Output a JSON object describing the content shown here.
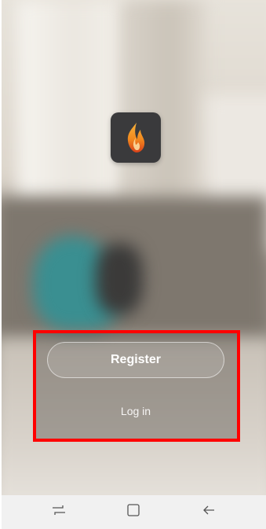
{
  "login_screen": {
    "app_icon": "flame-icon",
    "register_label": "Register",
    "login_label": "Log in"
  },
  "nav_bar": {
    "recents_icon": "recent-apps-icon",
    "home_icon": "home-icon",
    "back_icon": "back-arrow-icon"
  },
  "colors": {
    "highlight": "#ff0000",
    "app_icon_bg": "#3a3a3c",
    "flame_orange": "#f28a1e",
    "flame_red": "#d9411a",
    "nav_bg": "#f1f1f1"
  }
}
